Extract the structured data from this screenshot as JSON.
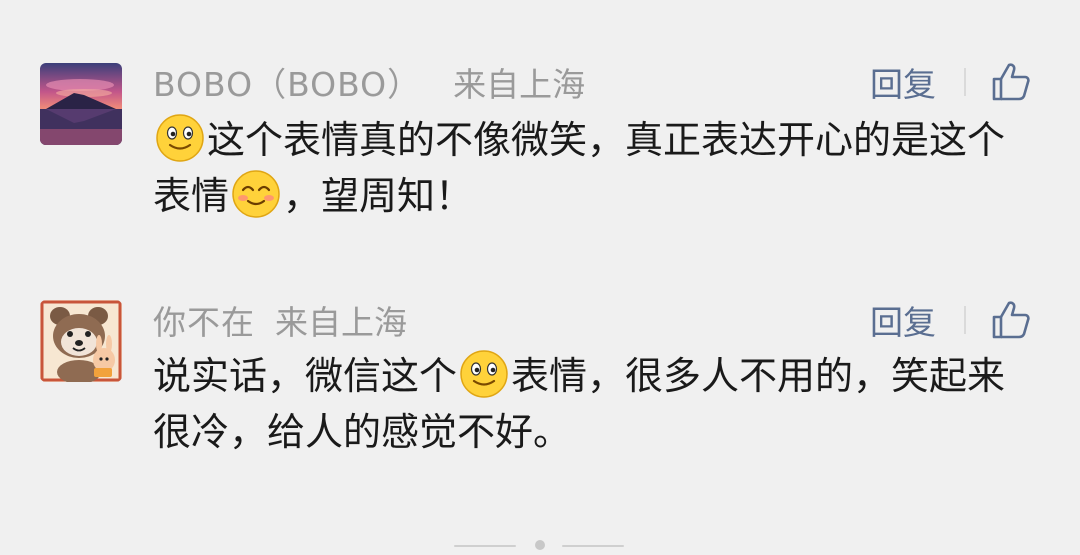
{
  "comments": [
    {
      "author": "BOBO（BOBO）",
      "location": "来自上海",
      "reply_label": "回复",
      "text_parts": [
        "这个表情真的不像微笑，真正表达开心的是这个表情",
        "，望周知！"
      ],
      "avatar_icon": "mountain-sunset-avatar",
      "emoji_1": "smile-emoji",
      "emoji_2": "blush-emoji"
    },
    {
      "author": "你不在",
      "location": "来自上海",
      "reply_label": "回复",
      "text_parts": [
        "说实话，微信这个",
        "表情，很多人不用的，笑起来很冷，给人的感觉不好。"
      ],
      "avatar_icon": "raccoon-cartoon-avatar",
      "emoji_1": "smile-emoji"
    }
  ],
  "colors": {
    "background": "#f0f0f0",
    "meta_text": "#9a9a9a",
    "reply_link": "#5a6e91",
    "body_text": "#1a1a1a"
  }
}
